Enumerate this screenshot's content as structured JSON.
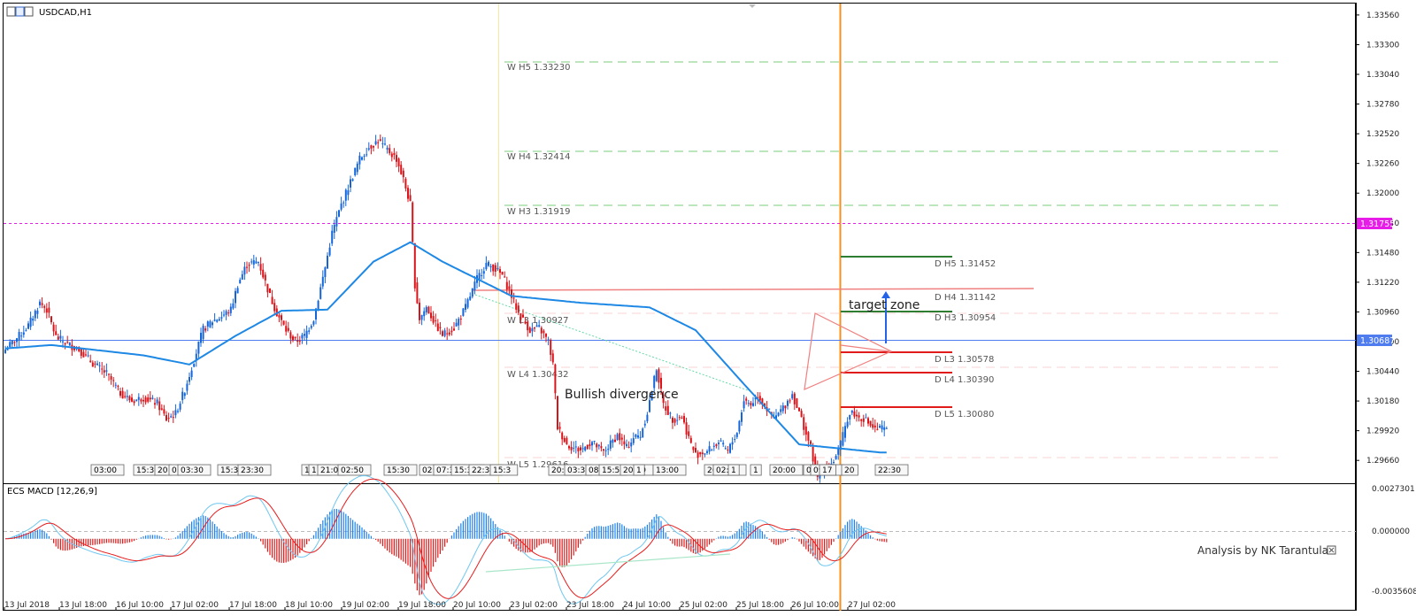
{
  "window": {
    "symbol_label": "USDCAD,H1"
  },
  "colors": {
    "up_candle": "#1565d8",
    "down_candle": "#d8141b",
    "ema": "#1e88e5",
    "pivot_weekly": "#7ccd7c",
    "pivot_magenta": "#e81ce8",
    "price_line": "#4f7df0",
    "vline_orange": "#f5921e",
    "vline_yellow": "#f6e79a",
    "d_green": "#2e7d32",
    "d_red": "#e01b1b",
    "d_resistance": "#f08080",
    "macd_pos": "#1e80f0",
    "macd_neg": "#e01b1b"
  },
  "price_axis": {
    "ticks": [
      "1.33560",
      "1.33300",
      "1.33040",
      "1.32780",
      "1.32520",
      "1.32260",
      "1.32000",
      "1.31740",
      "1.31480",
      "1.31220",
      "1.30960",
      "1.30700",
      "1.30440",
      "1.30180",
      "1.29920",
      "1.29660"
    ],
    "price_line_label": "1.30687",
    "magenta_label": "1.31755"
  },
  "weekly_pivots": [
    {
      "label": "W  H5 1.33230"
    },
    {
      "label": "W  H4 1.32414"
    },
    {
      "label": "W  H3 1.31919"
    },
    {
      "label": "W  L3 1.30927"
    },
    {
      "label": "W  L4 1.30432"
    },
    {
      "label": "W  L5 1.29616"
    }
  ],
  "daily_pivots": [
    {
      "label": "D   H5 1.31452"
    },
    {
      "label": "D   H4 1.31142"
    },
    {
      "label": "D   H3 1.30954"
    },
    {
      "label": "D   L3 1.30578"
    },
    {
      "label": "D   L4 1.30390"
    },
    {
      "label": "D   L5 1.30080"
    }
  ],
  "annotations": {
    "divergence": "Bullish divergence",
    "target": "target zone",
    "credit": "Analysis by NK Tarantula"
  },
  "session_boxes": [
    "03:00",
    "15:30",
    "20",
    "0",
    "03:30",
    "15:30",
    "23:30",
    "1",
    "17:",
    "21:0",
    "02:50",
    "15:30",
    "02:5",
    "07:30",
    "15:30",
    "22:30",
    "15:3",
    "20:00",
    "03:3",
    "08:00",
    "15:5",
    "20:00",
    "1",
    "13:00",
    "20:30",
    "02:50",
    "1",
    "1",
    "20:00",
    "02:30",
    "09:00",
    "17",
    "20",
    "22:30"
  ],
  "macd": {
    "title": "ECS MACD [12,26,9]",
    "ticks": [
      "0.0027301",
      "0.000000",
      "-0.0035608"
    ]
  },
  "time_axis": [
    "13 Jul 2018",
    "13 Jul 18:00",
    "16 Jul 10:00",
    "17 Jul 02:00",
    "17 Jul 18:00",
    "18 Jul 10:00",
    "19 Jul 02:00",
    "19 Jul 18:00",
    "20 Jul 10:00",
    "23 Jul 02:00",
    "23 Jul 18:00",
    "24 Jul 10:00",
    "25 Jul 02:00",
    "25 Jul 18:00",
    "26 Jul 10:00",
    "27 Jul 02:00"
  ],
  "chart_data": {
    "type": "candlestick",
    "title": "USDCAD,H1",
    "ylim": [
      1.2946,
      1.3366
    ],
    "anchors": [
      [
        0,
        1.3063
      ],
      [
        5,
        1.3073
      ],
      [
        10,
        1.3084
      ],
      [
        15,
        1.3104
      ],
      [
        18,
        1.3098
      ],
      [
        22,
        1.3074
      ],
      [
        27,
        1.3068
      ],
      [
        32,
        1.3063
      ],
      [
        38,
        1.3051
      ],
      [
        44,
        1.3042
      ],
      [
        50,
        1.3025
      ],
      [
        55,
        1.3018
      ],
      [
        60,
        1.3021
      ],
      [
        66,
        1.3016
      ],
      [
        70,
        1.3002
      ],
      [
        74,
        1.3007
      ],
      [
        78,
        1.3028
      ],
      [
        82,
        1.3054
      ],
      [
        86,
        1.3081
      ],
      [
        90,
        1.3088
      ],
      [
        94,
        1.3092
      ],
      [
        98,
        1.3098
      ],
      [
        101,
        1.312
      ],
      [
        105,
        1.3138
      ],
      [
        110,
        1.314
      ],
      [
        115,
        1.311
      ],
      [
        118,
        1.3095
      ],
      [
        122,
        1.308
      ],
      [
        126,
        1.307
      ],
      [
        130,
        1.3075
      ],
      [
        134,
        1.309
      ],
      [
        139,
        1.3135
      ],
      [
        142,
        1.3165
      ],
      [
        146,
        1.319
      ],
      [
        150,
        1.321
      ],
      [
        154,
        1.323
      ],
      [
        158,
        1.324
      ],
      [
        162,
        1.3246
      ],
      [
        166,
        1.3238
      ],
      [
        170,
        1.323
      ],
      [
        173,
        1.3212
      ],
      [
        176,
        1.319
      ],
      [
        178,
        1.312
      ],
      [
        180,
        1.309
      ],
      [
        183,
        1.31
      ],
      [
        187,
        1.3085
      ],
      [
        190,
        1.3076
      ],
      [
        195,
        1.3082
      ],
      [
        200,
        1.31
      ],
      [
        205,
        1.3125
      ],
      [
        209,
        1.3138
      ],
      [
        212,
        1.3135
      ],
      [
        216,
        1.3128
      ],
      [
        220,
        1.311
      ],
      [
        223,
        1.3095
      ],
      [
        228,
        1.308
      ],
      [
        232,
        1.3082
      ],
      [
        236,
        1.307
      ],
      [
        238,
        1.305
      ],
      [
        240,
        1.2995
      ],
      [
        244,
        1.298
      ],
      [
        247,
        1.2977
      ],
      [
        250,
        1.2975
      ],
      [
        255,
        1.2982
      ],
      [
        260,
        1.2973
      ],
      [
        266,
        1.2988
      ],
      [
        270,
        1.2977
      ],
      [
        273,
        1.2986
      ],
      [
        276,
        1.2988
      ],
      [
        279,
        1.3008
      ],
      [
        283,
        1.3047
      ],
      [
        286,
        1.3015
      ],
      [
        290,
        1.3002
      ],
      [
        294,
        1.3004
      ],
      [
        298,
        1.298
      ],
      [
        300,
        1.2971
      ],
      [
        305,
        1.2974
      ],
      [
        310,
        1.2982
      ],
      [
        314,
        1.2974
      ],
      [
        318,
        1.2991
      ],
      [
        321,
        1.3019
      ],
      [
        324,
        1.3015
      ],
      [
        327,
        1.3023
      ],
      [
        330,
        1.3014
      ],
      [
        334,
        1.3002
      ],
      [
        338,
        1.3012
      ],
      [
        342,
        1.3024
      ],
      [
        346,
        1.3002
      ],
      [
        350,
        1.2977
      ],
      [
        353,
        1.295
      ],
      [
        356,
        1.296
      ],
      [
        358,
        1.2961
      ],
      [
        360,
        1.2966
      ],
      [
        363,
        1.298
      ],
      [
        366,
        1.3003
      ],
      [
        368,
        1.3009
      ],
      [
        370,
        1.3004
      ],
      [
        373,
        1.3003
      ],
      [
        376,
        1.2997
      ],
      [
        378,
        1.2993
      ],
      [
        381,
        1.2994
      ],
      [
        383,
        1.2992
      ]
    ],
    "ema_anchors": [
      [
        0,
        1.3064
      ],
      [
        20,
        1.3067
      ],
      [
        60,
        1.3058
      ],
      [
        80,
        1.305
      ],
      [
        100,
        1.3075
      ],
      [
        120,
        1.3097
      ],
      [
        140,
        1.3098
      ],
      [
        160,
        1.314
      ],
      [
        176,
        1.3157
      ],
      [
        190,
        1.314
      ],
      [
        220,
        1.311
      ],
      [
        250,
        1.3104
      ],
      [
        280,
        1.31
      ],
      [
        300,
        1.308
      ],
      [
        320,
        1.3035
      ],
      [
        345,
        1.298
      ],
      [
        380,
        1.2973
      ]
    ]
  }
}
